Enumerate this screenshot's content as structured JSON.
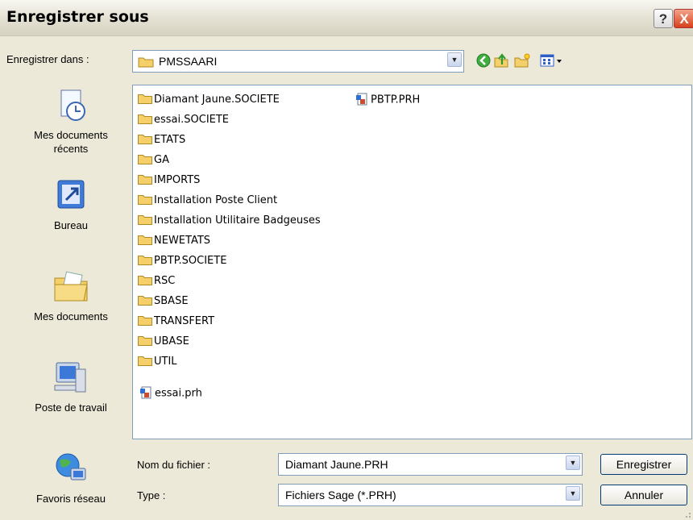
{
  "window": {
    "title": "Enregistrer sous",
    "help": "?",
    "close": "X"
  },
  "location": {
    "label": "Enregistrer dans :",
    "value": "PMSSAARI"
  },
  "toolbar": {
    "icons": [
      "back-icon",
      "up-folder-icon",
      "new-folder-icon",
      "view-menu-icon"
    ]
  },
  "places": [
    {
      "label": "Mes documents récents",
      "icon": "recent-documents-icon"
    },
    {
      "label": "Bureau",
      "icon": "desktop-icon"
    },
    {
      "label": "Mes documents",
      "icon": "my-documents-icon"
    },
    {
      "label": "Poste de travail",
      "icon": "my-computer-icon"
    },
    {
      "label": "Favoris réseau",
      "icon": "network-places-icon"
    }
  ],
  "files": [
    {
      "name": "Diamant Jaune.SOCIETE",
      "type": "folder"
    },
    {
      "name": "essai.SOCIETE",
      "type": "folder"
    },
    {
      "name": "ETATS",
      "type": "folder"
    },
    {
      "name": "GA",
      "type": "folder"
    },
    {
      "name": "IMPORTS",
      "type": "folder"
    },
    {
      "name": "Installation Poste Client",
      "type": "folder"
    },
    {
      "name": "Installation Utilitaire Badgeuses",
      "type": "folder"
    },
    {
      "name": "NEWETATS",
      "type": "folder"
    },
    {
      "name": "PBTP.SOCIETE",
      "type": "folder"
    },
    {
      "name": "RSC",
      "type": "folder"
    },
    {
      "name": "SBASE",
      "type": "folder"
    },
    {
      "name": "TRANSFERT",
      "type": "folder"
    },
    {
      "name": "UBASE",
      "type": "folder"
    },
    {
      "name": "UTIL",
      "type": "folder"
    },
    {
      "name": "essai.prh",
      "type": "file"
    },
    {
      "name": "PBTP.PRH",
      "type": "file"
    }
  ],
  "filename": {
    "label": "Nom du fichier :",
    "value": "Diamant Jaune.PRH"
  },
  "filetype": {
    "label": "Type :",
    "value": "Fichiers Sage (*.PRH)"
  },
  "buttons": {
    "save": "Enregistrer",
    "cancel": "Annuler"
  },
  "colors": {
    "folder": "#f5d06a",
    "accent": "#003c74",
    "input_border": "#7f9db9"
  }
}
